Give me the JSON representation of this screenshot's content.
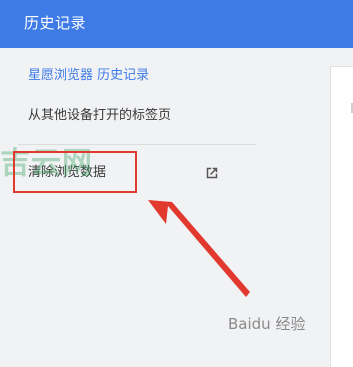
{
  "colors": {
    "accent": "#3e7be6",
    "highlight": "#e2392f"
  },
  "header": {
    "title": "历史记录"
  },
  "sidebar": {
    "items": [
      {
        "label": "星愿浏览器 历史记录",
        "active": true
      },
      {
        "label": "从其他设备打开的标签页",
        "active": false
      }
    ],
    "clear": {
      "label": "清除浏览数据",
      "icon": "open-in-new-icon"
    }
  },
  "watermarks": {
    "top": "吉云网",
    "bottom": "Baidu 经验"
  }
}
